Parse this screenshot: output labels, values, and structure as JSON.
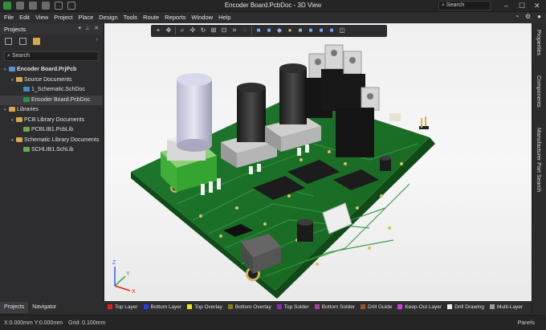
{
  "window": {
    "title": "Encoder Board.PcbDoc - 3D View",
    "search_placeholder": "Search"
  },
  "menu": [
    "File",
    "Edit",
    "View",
    "Project",
    "Place",
    "Design",
    "Tools",
    "Route",
    "Reports",
    "Window",
    "Help"
  ],
  "projects_panel": {
    "title": "Projects",
    "search_placeholder": "Search",
    "tree": [
      {
        "label": "Encoder Board.PrjPcb",
        "level": 0,
        "icon": "project-icon",
        "bold": true
      },
      {
        "label": "Source Documents",
        "level": 1,
        "icon": "folder-icon"
      },
      {
        "label": "1_Schematic.SchDoc",
        "level": 2,
        "icon": "schematic-doc-icon"
      },
      {
        "label": "Encoder Board.PcbDoc",
        "level": 2,
        "icon": "pcb-doc-icon",
        "selected": true
      },
      {
        "label": "Libraries",
        "level": 0,
        "icon": "folder-icon"
      },
      {
        "label": "PCB Library Documents",
        "level": 1,
        "icon": "folder-icon"
      },
      {
        "label": "PCBLIB1.PcbLib",
        "level": 2,
        "icon": "pcb-lib-icon"
      },
      {
        "label": "Schematic Library Documents",
        "level": 1,
        "icon": "folder-icon"
      },
      {
        "label": "SCHLIB1.SchLib",
        "level": 2,
        "icon": "sch-lib-icon"
      }
    ],
    "tabs": [
      "Projects",
      "Navigator"
    ]
  },
  "right_tabs": [
    "Properties",
    "Components",
    "Manufacturer Part Search"
  ],
  "layers": [
    {
      "name": "Top Layer",
      "color": "#e02020"
    },
    {
      "name": "Bottom Layer",
      "color": "#2a3fe0"
    },
    {
      "name": "Top Overlay",
      "color": "#f2e01a"
    },
    {
      "name": "Bottom Overlay",
      "color": "#8c7a1e"
    },
    {
      "name": "Top Solder",
      "color": "#8a2bb0"
    },
    {
      "name": "Bottom Solder",
      "color": "#b03a9a"
    },
    {
      "name": "Drill Guide",
      "color": "#a0522d"
    },
    {
      "name": "Keep-Out Layer",
      "color": "#d63ad6"
    },
    {
      "name": "Drill Drawing",
      "color": "#f0f0f0"
    },
    {
      "name": "Multi-Layer",
      "color": "#9a9a9a"
    }
  ],
  "status": {
    "coords": "X:0.000mm Y:0.000mm",
    "grid": "Grid: 0.100mm",
    "panels": "Panels"
  },
  "axes": {
    "x": "X",
    "y": "Y",
    "z": "Z"
  }
}
